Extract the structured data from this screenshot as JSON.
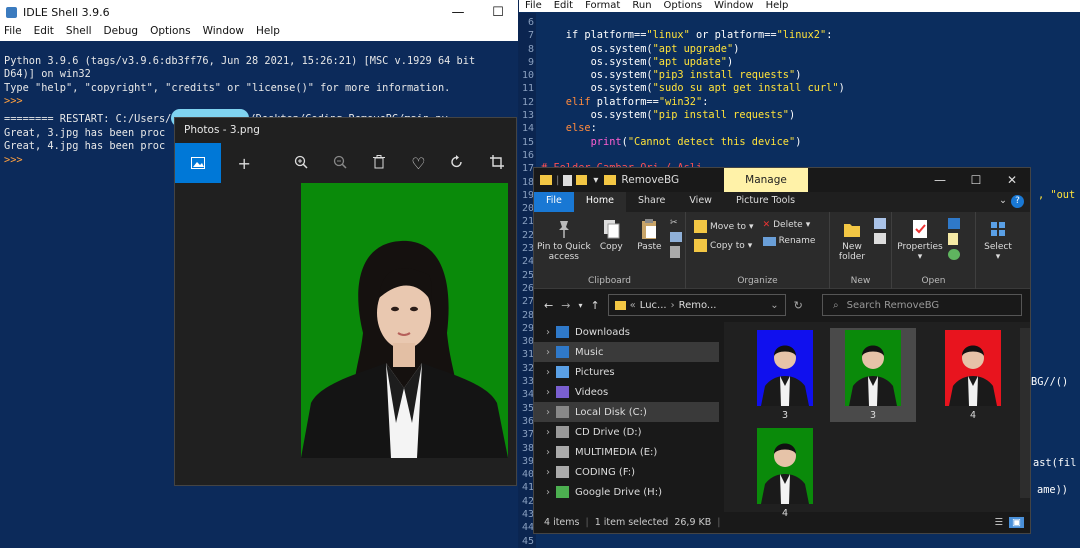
{
  "idle": {
    "title": "IDLE Shell 3.9.6",
    "menu": [
      "File",
      "Edit",
      "Shell",
      "Debug",
      "Options",
      "Window",
      "Help"
    ],
    "lines": [
      "Python 3.9.6 (tags/v3.9.6:db3ff76, Jun 28 2021, 15:26:21) [MSC v.1929 64 bit",
      "D64)] on win32",
      "Type \"help\", \"copyright\", \"credits\" or \"license()\" for more information."
    ],
    "prompt": ">>>",
    "restart_a": "======== RESTART: C:/Users/",
    "restart_b": "/Desktop/Coding RemoveBG/main.py ======",
    "great1": "Great, 3.jpg has been proc",
    "great2": "Great, 4.jpg has been proc"
  },
  "editor": {
    "menu": [
      "File",
      "Edit",
      "Format",
      "Run",
      "Options",
      "Window",
      "Help"
    ],
    "line_numbers": [
      "6",
      "7",
      "8",
      "9",
      "10",
      "11",
      "12",
      "13",
      "14",
      "15",
      "16",
      "17",
      "18",
      "19",
      "20",
      "21",
      "22",
      "23",
      "24",
      "25",
      "26",
      "27",
      "28",
      "29",
      "30",
      "31",
      "32",
      "33",
      "34",
      "35",
      "36",
      "37",
      "38",
      "39",
      "40",
      "41",
      "42",
      "43",
      "44",
      "45"
    ],
    "code": {
      "l6a": "    if platform==",
      "l6b": "\"linux\"",
      "l6c": " or platform==",
      "l6d": "\"linux2\"",
      "l6e": ":",
      "l7a": "        os.system(",
      "l7b": "\"apt upgrade\"",
      "l7c": ")",
      "l8a": "        os.system(",
      "l8b": "\"apt update\"",
      "l8c": ")",
      "l9a": "        os.system(",
      "l9b": "\"pip3 install requests\"",
      "l9c": ")",
      "l10a": "        os.system(",
      "l10b": "\"sudo su apt get install curl\"",
      "l10c": ")",
      "l11a": "    elif",
      "l11b": " platform==",
      "l11c": "\"win32\"",
      "l11d": ":",
      "l12a": "        os.system(",
      "l12b": "\"pip install requests\"",
      "l12c": ")",
      "l13a": "    else",
      "l13b": ":",
      "l14a": "        ",
      "l14b": "print",
      "l14c": "(",
      "l14d": "\"Cannot detect this device\"",
      "l14e": ")",
      "l16": "# Folder Gambar Ori / Asli",
      "frag19": ", \"out",
      "frag33": "BG//()",
      "frag40": "ast(fil",
      "frag42": "ame))"
    }
  },
  "photos": {
    "title": "Photos - 3.png"
  },
  "explorer": {
    "title": "RemoveBG",
    "manage": "Manage",
    "tabs": [
      "File",
      "Home",
      "Share",
      "View",
      "Picture Tools"
    ],
    "ribbon": {
      "pin": "Pin to Quick access",
      "copy": "Copy",
      "paste": "Paste",
      "clipboard": "Clipboard",
      "move_to": "Move to",
      "copy_to": "Copy to",
      "delete": "Delete",
      "rename": "Rename",
      "organize": "Organize",
      "new_folder": "New folder",
      "new": "New",
      "properties": "Properties",
      "open": "Open",
      "select": "Select"
    },
    "address": [
      "Luc...",
      "Remo..."
    ],
    "search_placeholder": "Search RemoveBG",
    "nav": [
      "Downloads",
      "Music",
      "Pictures",
      "Videos",
      "Local Disk (C:)",
      "CD Drive (D:)",
      "MULTIMEDIA (E:)",
      "CODING (F:)",
      "Google Drive (H:)"
    ],
    "files": [
      {
        "name": "3",
        "bg": "#1010ee"
      },
      {
        "name": "3",
        "bg": "#0a8a0a"
      },
      {
        "name": "4",
        "bg": "#e8141e"
      },
      {
        "name": "4",
        "bg": "#0a8a0a"
      }
    ],
    "status": {
      "items": "4 items",
      "selected": "1 item selected",
      "size": "26,9 KB"
    }
  }
}
